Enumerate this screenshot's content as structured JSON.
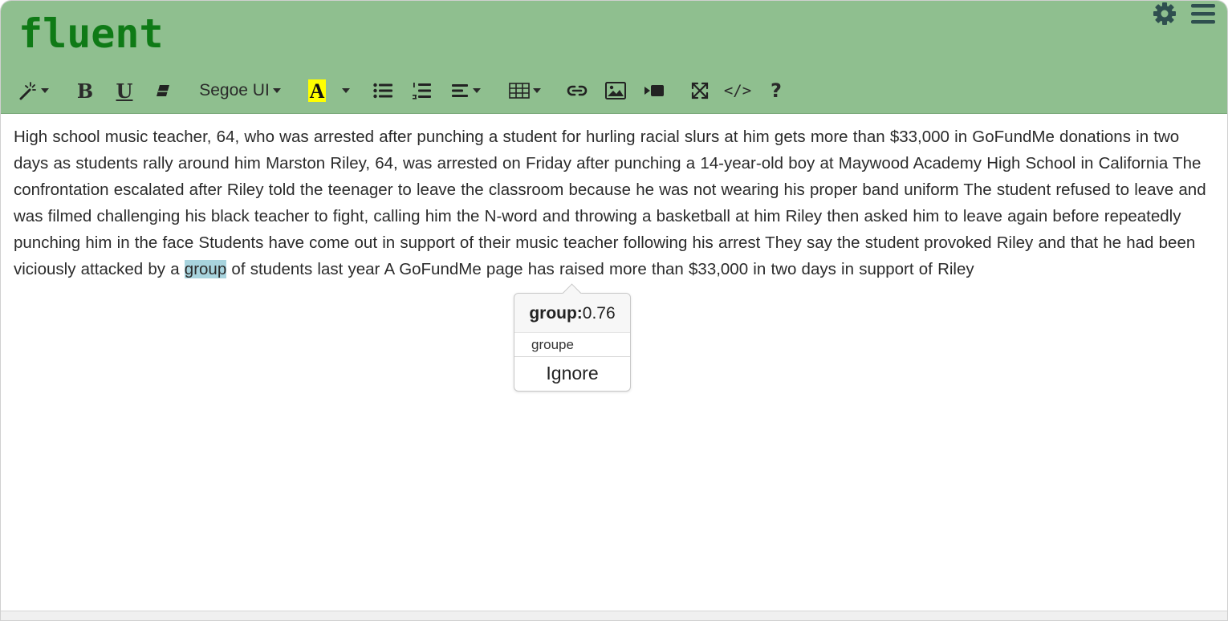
{
  "app": {
    "title": "fluent"
  },
  "header": {
    "icons": [
      "gear-icon",
      "hamburger-menu-icon"
    ]
  },
  "toolbar": {
    "magic_icon": "magic-wand-icon",
    "bold_label": "B",
    "underline_label": "U",
    "eraser_icon": "eraser-icon",
    "font_name": "Segoe UI",
    "color_label": "A",
    "highlight_color": "#ffff00",
    "bullet_icon": "unordered-list-icon",
    "numbered_icon": "ordered-list-icon",
    "align_icon": "align-left-icon",
    "table_icon": "table-icon",
    "link_icon": "link-icon",
    "image_icon": "image-icon",
    "video_icon": "video-icon",
    "fullscreen_icon": "fullscreen-icon",
    "code_label": "</>",
    "help_label": "?"
  },
  "editor": {
    "text_before": "High school music teacher, 64, who was arrested after punching a student for hurling racial slurs at him gets more than $33,000 in GoFundMe donations in two days as students rally around him Marston Riley, 64, was arrested on Friday after punching a 14-year-old boy at Maywood Academy High School in California The confrontation escalated after Riley told the teenager to leave the classroom because he was not wearing his proper band uniform The student refused to leave and was filmed challenging his black teacher to fight, calling him the N-word and throwing a basketball at him Riley then asked him to leave again before repeatedly punching him in the face Students have come out in support of their music teacher following his arrest They say the student provoked Riley and that he had been viciously attacked by a ",
    "flagged_word": "group",
    "text_after": " of students last year A GoFundMe page has raised more than $33,000 in two days in support of Riley",
    "flag_color": "#a8d4de"
  },
  "popup": {
    "word": "group:",
    "score": "0.76",
    "suggestion": "groupe",
    "ignore_label": "Ignore"
  },
  "colors": {
    "header_bg": "#8fbf8f",
    "logo": "#0f7a16",
    "icon": "#2f4f4f"
  }
}
